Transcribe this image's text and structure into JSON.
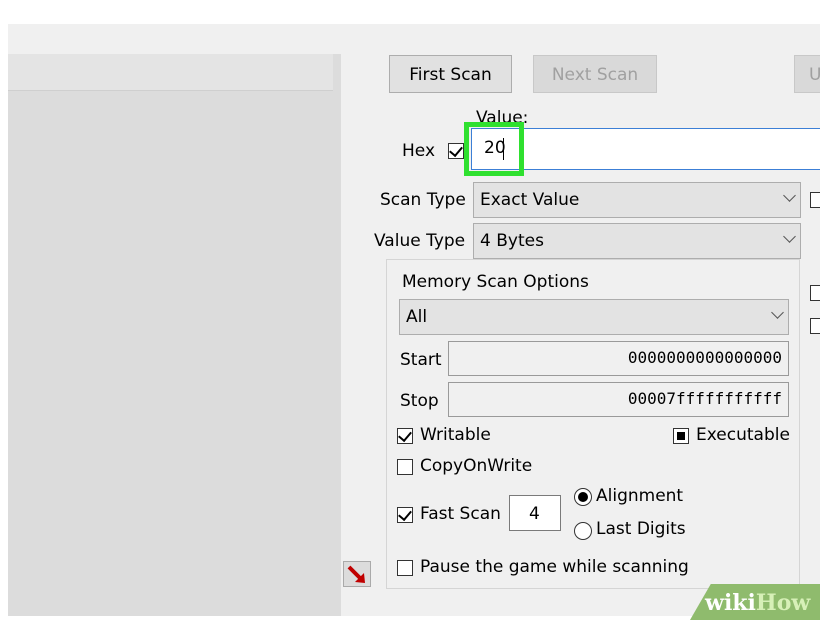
{
  "buttons": {
    "first_scan": "First Scan",
    "next_scan": "Next Scan",
    "undo_scan": "U"
  },
  "value": {
    "label": "Value:",
    "hex_label": "Hex",
    "hex_checked": true,
    "input_value": "20"
  },
  "scan_type": {
    "label": "Scan Type",
    "selected": "Exact Value"
  },
  "value_type": {
    "label": "Value Type",
    "selected": "4 Bytes"
  },
  "memory_scan_options": {
    "title": "Memory Scan Options",
    "region_selected": "All",
    "start_label": "Start",
    "start_value": "0000000000000000",
    "stop_label": "Stop",
    "stop_value": "00007fffffffffff",
    "writable_label": "Writable",
    "writable_checked": true,
    "executable_label": "Executable",
    "executable_state": "indeterminate",
    "copyonwrite_label": "CopyOnWrite",
    "copyonwrite_checked": false,
    "fast_scan_label": "Fast Scan",
    "fast_scan_checked": true,
    "fast_scan_value": "4",
    "alignment_label": "Alignment",
    "last_digits_label": "Last Digits",
    "selected_radio": "Alignment"
  },
  "pause_label": "Pause the game while scanning",
  "pause_checked": false,
  "watermark": {
    "wiki": "wiki",
    "how": "How"
  },
  "colors": {
    "highlight": "#2fe02f",
    "watermark_bg": "#8fbb6d"
  }
}
